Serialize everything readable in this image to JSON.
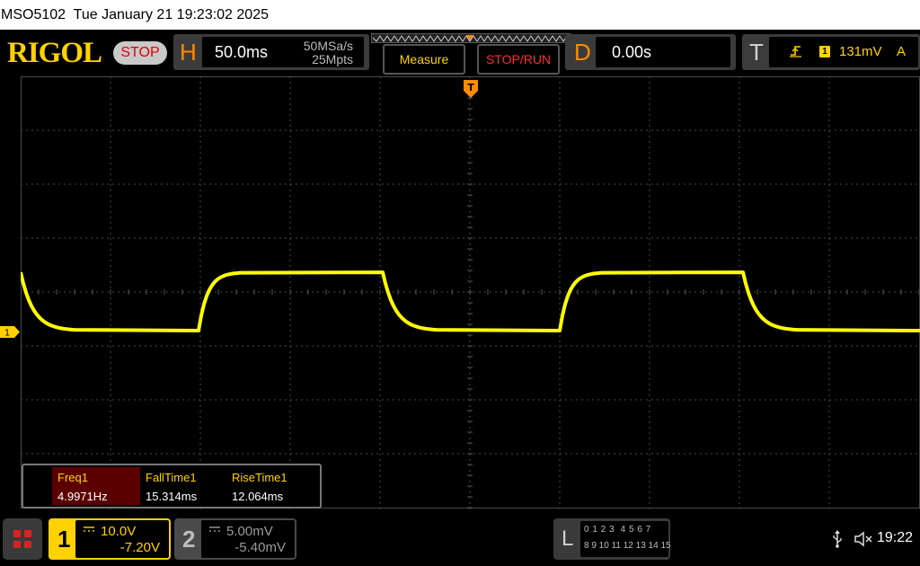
{
  "titlebar": {
    "text": "MSO5102  Tue January 21 19:23:02 2025"
  },
  "header": {
    "logo": "RIGOL",
    "run_state": "STOP",
    "horizontal": {
      "letter": "H",
      "timebase": "50.0ms",
      "sample_rate": "50MSa/s",
      "memory_depth": "25Mpts"
    },
    "measure_label": "Measure",
    "stoprun_label": "STOP/RUN",
    "delay": {
      "letter": "D",
      "value": "0.00s"
    },
    "trigger": {
      "letter": "T",
      "source": "1",
      "level": "131mV",
      "mode": "A"
    }
  },
  "waveform": {
    "channel": "1",
    "color": "#ffff00",
    "low_level_div": 1.0,
    "high_level_div": -0.3
  },
  "measurements": [
    {
      "label": "Freq1",
      "value": "4.9971Hz"
    },
    {
      "label": "FallTime1",
      "value": "15.314ms"
    },
    {
      "label": "RiseTime1",
      "value": "12.064ms"
    }
  ],
  "channels": [
    {
      "number": "1",
      "scale": "10.0V",
      "offset": "-7.20V",
      "active": true
    },
    {
      "number": "2",
      "scale": "5.00mV",
      "offset": "-5.40mV",
      "active": false
    }
  ],
  "logic": {
    "letter": "L",
    "row1": "0 1 2 3  4 5 6 7",
    "row2": "8 9 10 11 12 13 14 15"
  },
  "status": {
    "time": "19:22"
  },
  "colors": {
    "accent": "#ffd200",
    "trigger": "#ff8c00",
    "stop": "#e00000"
  }
}
